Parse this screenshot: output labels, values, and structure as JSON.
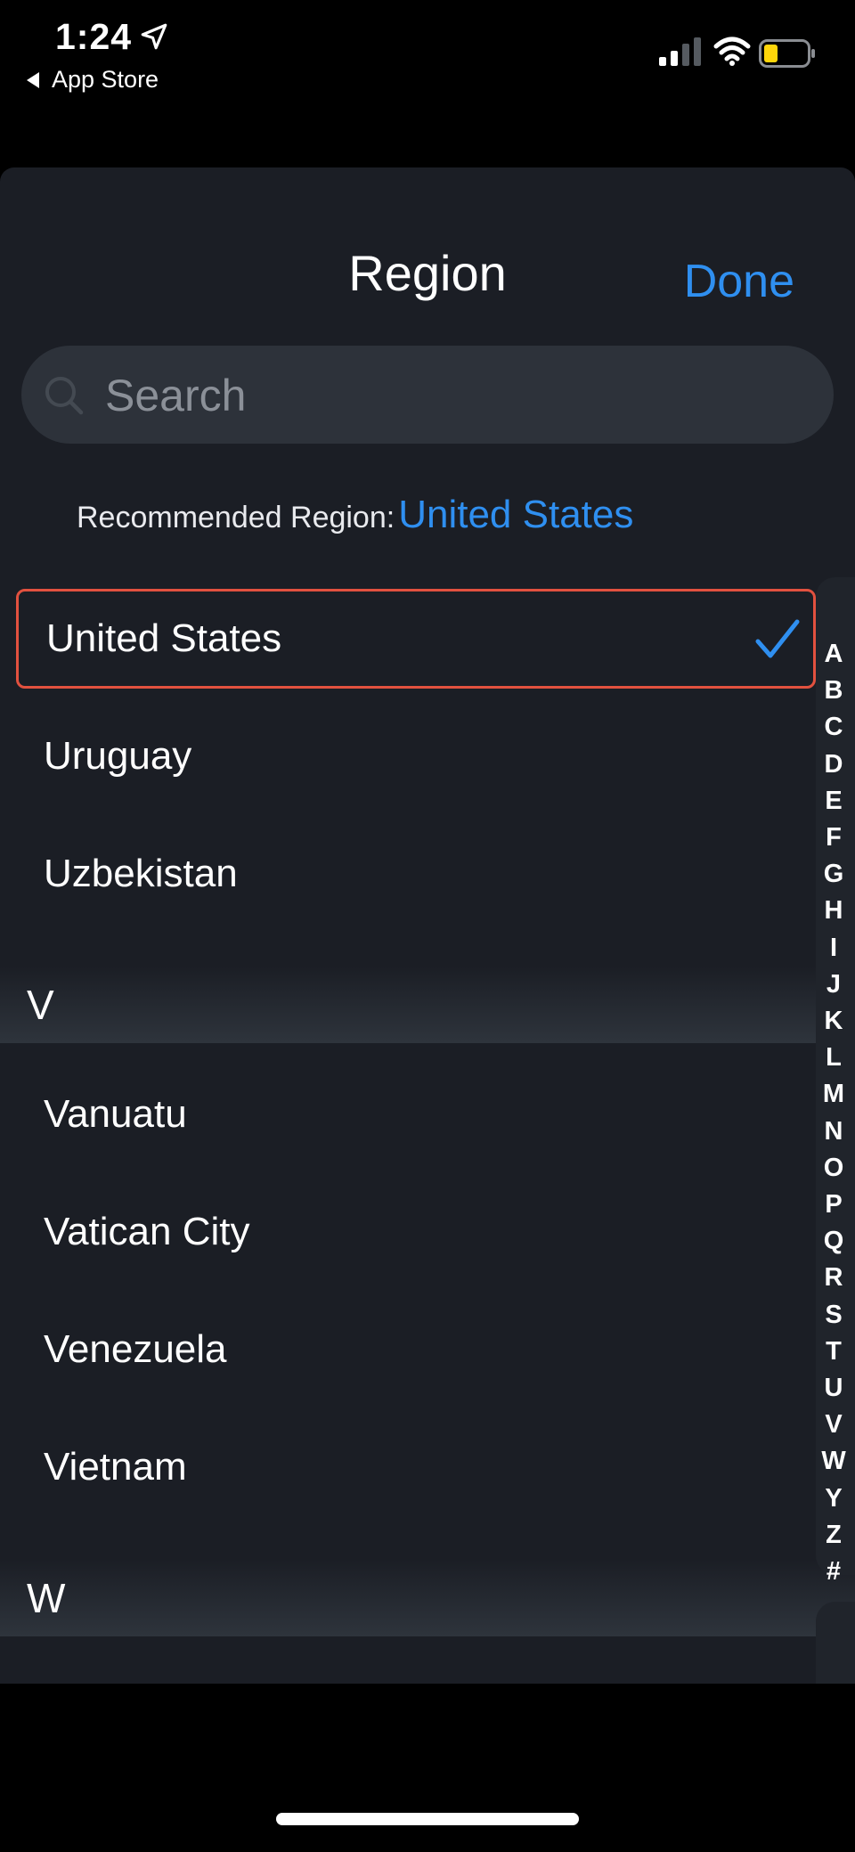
{
  "status_bar": {
    "time": "1:24",
    "back_label": "App Store",
    "icons": [
      "location-arrow-icon",
      "cellular-signal-icon",
      "wifi-icon",
      "battery-icon"
    ]
  },
  "sheet": {
    "title": "Region",
    "done_label": "Done",
    "search_placeholder": "Search",
    "recommended_label": "Recommended Region:",
    "recommended_value": "United States"
  },
  "list": {
    "selected": "United States",
    "u_rows": [
      "Uruguay",
      "Uzbekistan"
    ],
    "sections": [
      {
        "header": "V",
        "rows": [
          "Vanuatu",
          "Vatican City",
          "Venezuela",
          "Vietnam"
        ]
      },
      {
        "header": "W",
        "rows": []
      }
    ]
  },
  "index_letters": [
    "A",
    "B",
    "C",
    "D",
    "E",
    "F",
    "G",
    "H",
    "I",
    "J",
    "K",
    "L",
    "M",
    "N",
    "O",
    "P",
    "Q",
    "R",
    "S",
    "T",
    "U",
    "V",
    "W",
    "Y",
    "Z",
    "#"
  ],
  "colors": {
    "accent": "#2f8ff0",
    "selection_border": "#e2513f",
    "sheet_bg": "#1b1e25",
    "search_bg": "#2d323a",
    "battery_fill": "#ffd60a"
  }
}
